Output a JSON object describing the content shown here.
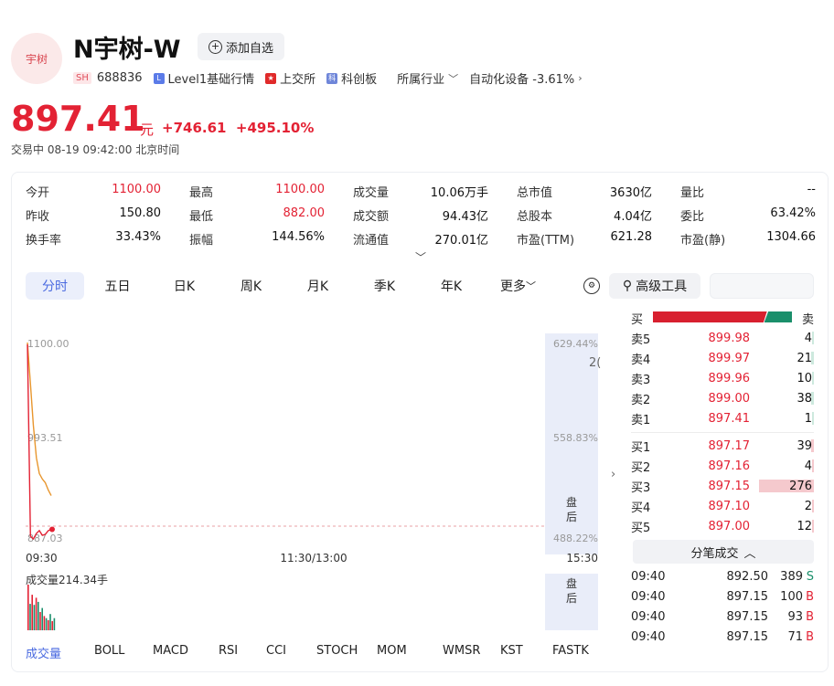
{
  "header": {
    "logo_text": "宇树",
    "name": "N宇树-W",
    "watch_label": "添加自选",
    "market_tag": "SH",
    "code": "688836",
    "level_label": "Level1基础行情",
    "exchange": "上交所",
    "board": "科创板",
    "industry_label": "所属行业",
    "industry_value": "自动化设备 -3.61%"
  },
  "quote": {
    "price": "897.41",
    "unit": "元",
    "change": "+746.61",
    "change_pct": "+495.10%",
    "status": "交易中  08-19 09:42:00  北京时间"
  },
  "stats": [
    {
      "label": "今开",
      "value": "1100.00",
      "red": true
    },
    {
      "label": "最高",
      "value": "1100.00",
      "red": true
    },
    {
      "label": "成交量",
      "value": "10.06万手",
      "red": false
    },
    {
      "label": "总市值",
      "value": "3630亿",
      "red": false
    },
    {
      "label": "量比",
      "value": "--",
      "red": false
    },
    {
      "label": "昨收",
      "value": "150.80",
      "red": false
    },
    {
      "label": "最低",
      "value": "882.00",
      "red": true
    },
    {
      "label": "成交额",
      "value": "94.43亿",
      "red": false
    },
    {
      "label": "总股本",
      "value": "4.04亿",
      "red": false
    },
    {
      "label": "委比",
      "value": "63.42%",
      "red": false
    },
    {
      "label": "换手率",
      "value": "33.43%",
      "red": false
    },
    {
      "label": "振幅",
      "value": "144.56%",
      "red": false
    },
    {
      "label": "流通值",
      "value": "270.01亿",
      "red": false
    },
    {
      "label": "市盈(TTM)",
      "value": "621.28",
      "red": false
    },
    {
      "label": "市盈(静)",
      "value": "1304.66",
      "red": false
    }
  ],
  "tabs": [
    "分时",
    "五日",
    "日K",
    "周K",
    "月K",
    "季K",
    "年K",
    "更多"
  ],
  "tool_label": "高级工具",
  "chart": {
    "y_high": "1100.00",
    "y_mid": "993.51",
    "y_low": "887.03",
    "pct_high": "629.44%",
    "pct_mid": "558.83%",
    "pct_low": "488.22%",
    "x_start": "09:30",
    "x_mid": "11:30/13:00",
    "x_end": "15:30",
    "after_hours": "盘后",
    "peek_text": "2(",
    "volume_label": "成交量214.34手"
  },
  "chart_data": {
    "type": "line",
    "title": "",
    "xlabel": "",
    "ylabel": "",
    "ylim": [
      887.03,
      1100.0
    ],
    "series": [
      {
        "name": "",
        "values": [
          1100.0,
          1055.0,
          1010.0,
          975.0,
          958.0,
          952.0,
          948.0,
          940.0,
          934.0
        ]
      },
      {
        "name": "",
        "values": [
          1098.0,
          890.0,
          884.0,
          893.0,
          896.0,
          891.0,
          892.0,
          896.0,
          897.41
        ]
      }
    ],
    "volume": [
      45,
      26,
      35,
      25,
      32,
      28,
      18,
      22,
      14,
      12,
      10,
      16,
      9,
      12
    ]
  },
  "indicators": [
    "成交量",
    "BOLL",
    "MACD",
    "RSI",
    "CCI",
    "STOCH",
    "MOM",
    "WMSR",
    "KST",
    "FASTK"
  ],
  "orderbook": {
    "buy_label": "买",
    "sell_label": "卖",
    "buy_ratio": 0.82,
    "asks": [
      {
        "label": "卖5",
        "price": "899.98",
        "vol": "4",
        "frac": 0.01
      },
      {
        "label": "卖4",
        "price": "899.97",
        "vol": "21",
        "frac": 0.03
      },
      {
        "label": "卖3",
        "price": "899.96",
        "vol": "10",
        "frac": 0.01
      },
      {
        "label": "卖2",
        "price": "899.00",
        "vol": "38",
        "frac": 0.03
      },
      {
        "label": "卖1",
        "price": "897.41",
        "vol": "1",
        "frac": 0.01
      }
    ],
    "bids": [
      {
        "label": "买1",
        "price": "897.17",
        "vol": "39",
        "frac": 0.03
      },
      {
        "label": "买2",
        "price": "897.16",
        "vol": "4",
        "frac": 0.01
      },
      {
        "label": "买3",
        "price": "897.15",
        "vol": "276",
        "frac": 0.6
      },
      {
        "label": "买4",
        "price": "897.10",
        "vol": "2",
        "frac": 0.01
      },
      {
        "label": "买5",
        "price": "897.00",
        "vol": "12",
        "frac": 0.01
      }
    ]
  },
  "ticks_title": "分笔成交",
  "ticks": [
    {
      "time": "09:40",
      "price": "892.50",
      "vol": "389",
      "side": "S"
    },
    {
      "time": "09:40",
      "price": "897.15",
      "vol": "100",
      "side": "B"
    },
    {
      "time": "09:40",
      "price": "897.15",
      "vol": "93",
      "side": "B"
    },
    {
      "time": "09:40",
      "price": "897.15",
      "vol": "71",
      "side": "B"
    }
  ]
}
